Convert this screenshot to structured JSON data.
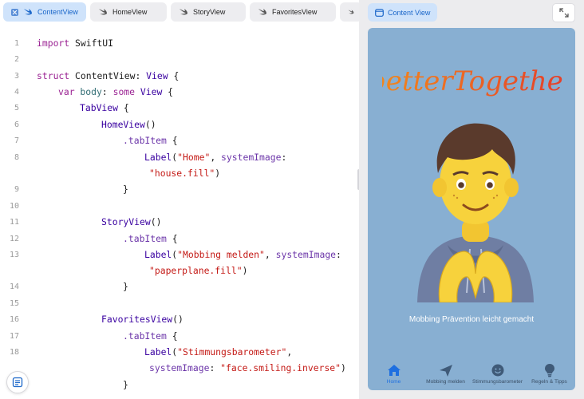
{
  "editor": {
    "tabs": [
      {
        "label": "ContentView",
        "active": true,
        "icon": "close-square-icon"
      },
      {
        "label": "HomeView",
        "active": false,
        "icon": "swift-icon"
      },
      {
        "label": "StoryView",
        "active": false,
        "icon": "swift-icon"
      },
      {
        "label": "FavoritesView",
        "active": false,
        "icon": "swift-icon"
      },
      {
        "label": "",
        "active": false,
        "icon": "swift-icon"
      }
    ],
    "line_numbers": [
      "1",
      "2",
      "3",
      "4",
      "5",
      "6",
      "7",
      "8",
      "",
      "9",
      "10",
      "11",
      "12",
      "13",
      "",
      "14",
      "15",
      "16",
      "17",
      "18",
      "",
      "19"
    ],
    "code": {
      "l1_kw": "import",
      "l1_rest": " SwiftUI",
      "l3_kw": "struct",
      "l3_name": " ContentView",
      "l3_colon": ": ",
      "l3_type": "View",
      "l3_brace": " {",
      "l4_kw1": "var",
      "l4_body": " body",
      "l4_colon": ": ",
      "l4_kw2": "some",
      "l4_sp": " ",
      "l4_type": "View",
      "l4_brace": " {",
      "l5_type": "TabView",
      "l5_brace": " {",
      "l6_type": "HomeView",
      "l6_paren": "()",
      "l7_mod": ".tabItem",
      "l7_brace": " {",
      "l8_type": "Label",
      "l8_open": "(",
      "l8_str": "\"Home\"",
      "l8_sep": ", ",
      "l8_param": "systemImage",
      "l8_colon": ":",
      "l8b_str": "\"house.fill\"",
      "l8b_close": ")",
      "l9_brace": "}",
      "l11_type": "StoryView",
      "l11_paren": "()",
      "l12_mod": ".tabItem",
      "l12_brace": " {",
      "l13_type": "Label",
      "l13_open": "(",
      "l13_str": "\"Mobbing melden\"",
      "l13_sep": ", ",
      "l13_param": "systemImage",
      "l13_colon": ":",
      "l13b_str": "\"paperplane.fill\"",
      "l13b_close": ")",
      "l14_brace": "}",
      "l16_type": "FavoritesView",
      "l16_paren": "()",
      "l17_mod": ".tabItem",
      "l17_brace": " {",
      "l18_type": "Label",
      "l18_open": "(",
      "l18_str": "\"Stimmungsbarometer\"",
      "l18_sep": ",",
      "l18b_param": "systemImage",
      "l18b_colon": ": ",
      "l18b_str": "\"face.smiling.inverse\"",
      "l18b_close": ")",
      "l19_brace": "}"
    }
  },
  "preview": {
    "tab_label": "Content View",
    "logo_text": "betterTogether",
    "tagline": "Mobbing Prävention leicht gemacht",
    "tab_items": [
      {
        "label": "Home",
        "icon": "house-fill-icon",
        "active": true
      },
      {
        "label": "Mobbing melden",
        "icon": "paperplane-fill-icon",
        "active": false
      },
      {
        "label": "Stimmungsbarometer",
        "icon": "face-smiling-icon",
        "active": false
      },
      {
        "label": "Regeln & Tipps",
        "icon": "lightbulb-fill-icon",
        "active": false
      }
    ]
  },
  "colors": {
    "accent": "#1a66c9",
    "keyword": "#9b2393",
    "string": "#c41a16",
    "type": "#3900a0",
    "preview_bg": "#88afd2",
    "logo_start": "#f28c1c",
    "logo_end": "#e43a2b"
  }
}
